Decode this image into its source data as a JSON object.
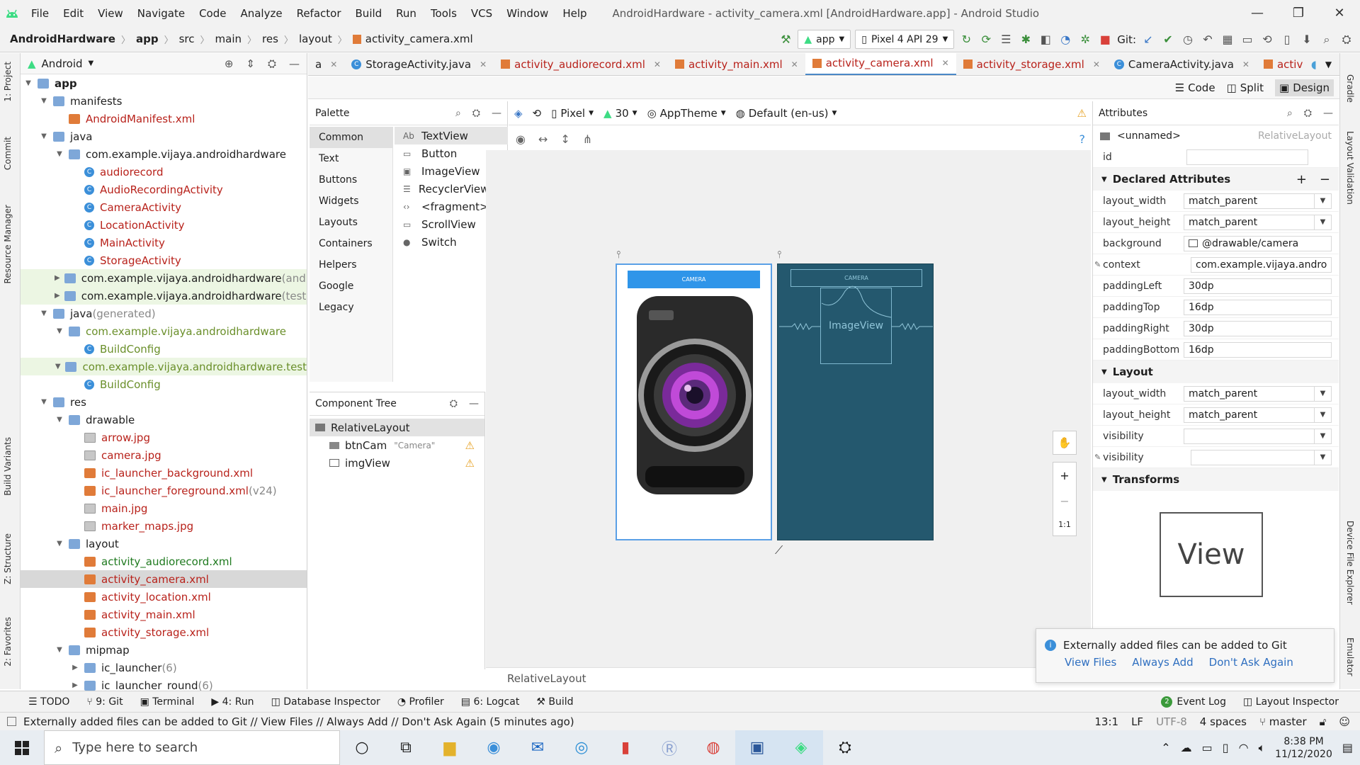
{
  "menu": {
    "items": [
      "File",
      "Edit",
      "View",
      "Navigate",
      "Code",
      "Analyze",
      "Refactor",
      "Build",
      "Run",
      "Tools",
      "VCS",
      "Window",
      "Help"
    ],
    "window_title": "AndroidHardware - activity_camera.xml [AndroidHardware.app] - Android Studio"
  },
  "breadcrumb": [
    "AndroidHardware",
    "app",
    "src",
    "main",
    "res",
    "layout",
    "activity_camera.xml"
  ],
  "toolbar": {
    "run_config": "app",
    "device": "Pixel 4 API 29",
    "git_label": "Git:"
  },
  "left_tabs": [
    "1: Project",
    "Commit",
    "Resource Manager",
    "Build Variants",
    "Z: Structure",
    "2: Favorites"
  ],
  "right_tabs": [
    "Gradle",
    "Layout Validation",
    "Device File Explorer",
    "Emulator"
  ],
  "project": {
    "view": "Android",
    "nodes": [
      {
        "label": "app",
        "level": 0,
        "kind": "folder",
        "bold": true,
        "open": true
      },
      {
        "label": "manifests",
        "level": 1,
        "kind": "folder",
        "open": true
      },
      {
        "label": "AndroidManifest.xml",
        "level": 2,
        "kind": "manifest",
        "color": "#b8221b"
      },
      {
        "label": "java",
        "level": 1,
        "kind": "folder",
        "open": true
      },
      {
        "label": "com.example.vijaya.androidhardware",
        "level": 2,
        "kind": "pkg",
        "open": true
      },
      {
        "label": "audiorecord",
        "level": 3,
        "kind": "class",
        "color": "#b8221b"
      },
      {
        "label": "AudioRecordingActivity",
        "level": 3,
        "kind": "class",
        "color": "#b8221b"
      },
      {
        "label": "CameraActivity",
        "level": 3,
        "kind": "class",
        "color": "#b8221b"
      },
      {
        "label": "LocationActivity",
        "level": 3,
        "kind": "class",
        "color": "#b8221b"
      },
      {
        "label": "MainActivity",
        "level": 3,
        "kind": "class",
        "color": "#b8221b"
      },
      {
        "label": "StorageActivity",
        "level": 3,
        "kind": "class",
        "color": "#b8221b"
      },
      {
        "label": "com.example.vijaya.androidhardware",
        "suffix": " (androidT",
        "level": 2,
        "kind": "pkg",
        "closed": true,
        "green": true
      },
      {
        "label": "com.example.vijaya.androidhardware",
        "suffix": " (test)",
        "level": 2,
        "kind": "pkg",
        "closed": true,
        "green": true
      },
      {
        "label": "java",
        "suffix": " (generated)",
        "level": 1,
        "kind": "folder",
        "open": true
      },
      {
        "label": "com.example.vijaya.androidhardware",
        "level": 2,
        "kind": "pkg",
        "open": true,
        "color": "#6a8f2a"
      },
      {
        "label": "BuildConfig",
        "level": 3,
        "kind": "class",
        "color": "#6a8f2a"
      },
      {
        "label": "com.example.vijaya.androidhardware.test",
        "level": 2,
        "kind": "pkg",
        "open": true,
        "green": true,
        "color": "#6a8f2a"
      },
      {
        "label": "BuildConfig",
        "level": 3,
        "kind": "class",
        "color": "#6a8f2a"
      },
      {
        "label": "res",
        "level": 1,
        "kind": "folder",
        "open": true
      },
      {
        "label": "drawable",
        "level": 2,
        "kind": "folder",
        "open": true
      },
      {
        "label": "arrow.jpg",
        "level": 3,
        "kind": "jpg",
        "color": "#b8221b"
      },
      {
        "label": "camera.jpg",
        "level": 3,
        "kind": "jpg",
        "color": "#b8221b"
      },
      {
        "label": "ic_launcher_background.xml",
        "level": 3,
        "kind": "xml",
        "color": "#b8221b"
      },
      {
        "label": "ic_launcher_foreground.xml",
        "suffix": " (v24)",
        "level": 3,
        "kind": "xml",
        "color": "#b8221b"
      },
      {
        "label": "main.jpg",
        "level": 3,
        "kind": "jpg",
        "color": "#b8221b"
      },
      {
        "label": "marker_maps.jpg",
        "level": 3,
        "kind": "jpg",
        "color": "#b8221b"
      },
      {
        "label": "layout",
        "level": 2,
        "kind": "folder",
        "open": true
      },
      {
        "label": "activity_audiorecord.xml",
        "level": 3,
        "kind": "xml",
        "color": "#1f7a1f"
      },
      {
        "label": "activity_camera.xml",
        "level": 3,
        "kind": "xml",
        "color": "#b8221b",
        "selected": true
      },
      {
        "label": "activity_location.xml",
        "level": 3,
        "kind": "xml",
        "color": "#b8221b"
      },
      {
        "label": "activity_main.xml",
        "level": 3,
        "kind": "xml",
        "color": "#b8221b"
      },
      {
        "label": "activity_storage.xml",
        "level": 3,
        "kind": "xml",
        "color": "#b8221b"
      },
      {
        "label": "mipmap",
        "level": 2,
        "kind": "folder",
        "open": true
      },
      {
        "label": "ic_launcher",
        "suffix": " (6)",
        "level": 3,
        "kind": "folder",
        "closed": true
      },
      {
        "label": "ic_launcher_round",
        "suffix": " (6)",
        "level": 3,
        "kind": "folder",
        "closed": true
      }
    ]
  },
  "editor_tabs": [
    {
      "label": "a",
      "kind": "xml"
    },
    {
      "label": "StorageActivity.java",
      "kind": "class"
    },
    {
      "label": "activity_audiorecord.xml",
      "kind": "xml"
    },
    {
      "label": "activity_main.xml",
      "kind": "xml"
    },
    {
      "label": "activity_camera.xml",
      "kind": "xml",
      "active": true
    },
    {
      "label": "activity_storage.xml",
      "kind": "xml"
    },
    {
      "label": "CameraActivity.java",
      "kind": "class"
    },
    {
      "label": "activity_location.xml",
      "kind": "xml"
    }
  ],
  "view_modes": {
    "code": "Code",
    "split": "Split",
    "design": "Design"
  },
  "palette": {
    "title": "Palette",
    "categories": [
      "Common",
      "Text",
      "Buttons",
      "Widgets",
      "Layouts",
      "Containers",
      "Helpers",
      "Google",
      "Legacy"
    ],
    "items": [
      {
        "label": "TextView",
        "icon": "Ab"
      },
      {
        "label": "Button",
        "icon": "▭"
      },
      {
        "label": "ImageView",
        "icon": "▣"
      },
      {
        "label": "RecyclerView",
        "icon": "☰"
      },
      {
        "label": "<fragment>",
        "icon": "‹›"
      },
      {
        "label": "ScrollView",
        "icon": "▭"
      },
      {
        "label": "Switch",
        "icon": "●"
      }
    ]
  },
  "component_tree": {
    "title": "Component Tree",
    "root": "RelativeLayout",
    "children": [
      {
        "label": "btnCam",
        "hint": "\"Camera\""
      },
      {
        "label": "imgView",
        "hint": ""
      }
    ]
  },
  "design_toolbar": {
    "device": "Pixel",
    "api": "30",
    "theme": "AppTheme",
    "locale": "Default (en-us)"
  },
  "preview": {
    "button_text": "CAMERA",
    "blueprint_button_text": "CAMERA",
    "blueprint_image_label": "ImageView",
    "breadcrumb": "RelativeLayout",
    "zoom_label": "1:1"
  },
  "attributes": {
    "title": "Attributes",
    "element": "<unnamed>",
    "element_type": "RelativeLayout",
    "id_label": "id",
    "id_value": "",
    "declared_title": "Declared Attributes",
    "declared": [
      {
        "key": "layout_width",
        "value": "match_parent",
        "dropdown": true
      },
      {
        "key": "layout_height",
        "value": "match_parent",
        "dropdown": true
      },
      {
        "key": "background",
        "value": "@drawable/camera"
      },
      {
        "key": "context",
        "value": "com.example.vijaya.andro"
      },
      {
        "key": "paddingLeft",
        "value": "30dp"
      },
      {
        "key": "paddingTop",
        "value": "16dp"
      },
      {
        "key": "paddingRight",
        "value": "30dp"
      },
      {
        "key": "paddingBottom",
        "value": "16dp"
      }
    ],
    "layout_title": "Layout",
    "layout": [
      {
        "key": "layout_width",
        "value": "match_parent"
      },
      {
        "key": "layout_height",
        "value": "match_parent"
      },
      {
        "key": "visibility",
        "value": ""
      },
      {
        "key": "visibility",
        "value": ""
      }
    ],
    "transforms_title": "Transforms",
    "view_label": "View"
  },
  "notification": {
    "message": "Externally added files can be added to Git",
    "actions": [
      "View Files",
      "Always Add",
      "Don't Ask Again"
    ]
  },
  "bottom_tabs": [
    "TODO",
    "9: Git",
    "Terminal",
    "4: Run",
    "Database Inspector",
    "Profiler",
    "6: Logcat",
    "Build"
  ],
  "bottom_right": {
    "event_log": "Event Log",
    "event_count": "2",
    "layout_inspector": "Layout Inspector"
  },
  "status": {
    "message": "Externally added files can be added to Git // View Files // Always Add // Don't Ask Again (5 minutes ago)",
    "position": "13:1",
    "line_sep": "LF",
    "encoding": "UTF-8",
    "indent": "4 spaces",
    "branch": "master"
  },
  "taskbar": {
    "search_placeholder": "Type here to search",
    "time": "8:38 PM",
    "date": "11/12/2020"
  }
}
